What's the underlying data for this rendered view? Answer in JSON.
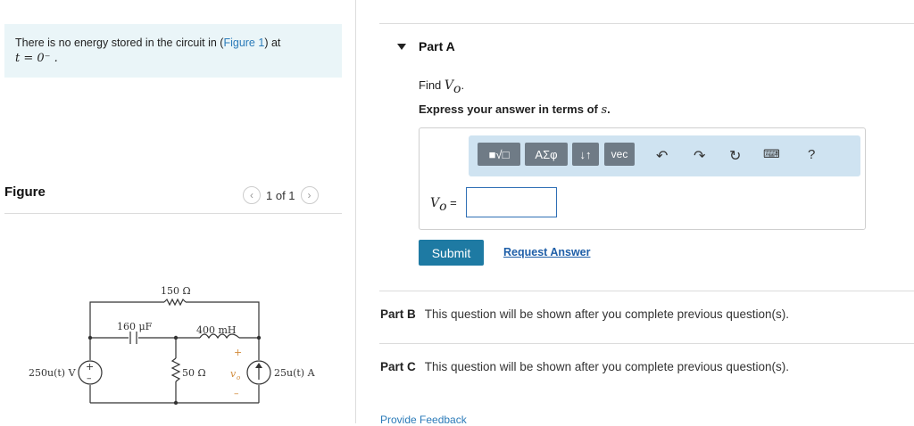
{
  "problem": {
    "intro_text": "There is no energy stored in the circuit in (",
    "figure_link": "Figure 1",
    "intro_text_after": ") at",
    "time_expr": "t = 0⁻ ."
  },
  "figure": {
    "title": "Figure",
    "pager_text": "1 of 1",
    "prev_icon": "chevron-left-icon",
    "next_icon": "chevron-right-icon",
    "circuit_labels": {
      "r150": "150 Ω",
      "cap": "160 μF",
      "ind": "400 mH",
      "r50": "50 Ω",
      "vsrc": "250u(t) V",
      "isrc": "25u(t) A",
      "vo": "v",
      "vo_sub": "o",
      "plus": "+",
      "minus": "–"
    }
  },
  "partA": {
    "label": "Part A",
    "find_text": "Find",
    "find_var": "V",
    "find_sub": "o",
    "find_end": ".",
    "express_text": "Express your answer in terms of",
    "express_var": "s",
    "express_end": ".",
    "toolbar": {
      "templates_label": "■√□",
      "greek_label": "ΑΣφ",
      "arrows_label": "↓↑",
      "vec_label": "vec",
      "undo_icon": "undo-icon",
      "redo_icon": "redo-icon",
      "reset_icon": "reset-icon",
      "keyboard_icon": "keyboard-icon",
      "help_label": "?"
    },
    "answer_var": "V",
    "answer_sub": "o",
    "answer_eq": " =",
    "answer_value": "",
    "submit_label": "Submit",
    "request_label": "Request Answer"
  },
  "partB": {
    "label": "Part B",
    "text": "This question will be shown after you complete previous question(s)."
  },
  "partC": {
    "label": "Part C",
    "text": "This question will be shown after you complete previous question(s)."
  },
  "feedback_label": "Provide Feedback"
}
